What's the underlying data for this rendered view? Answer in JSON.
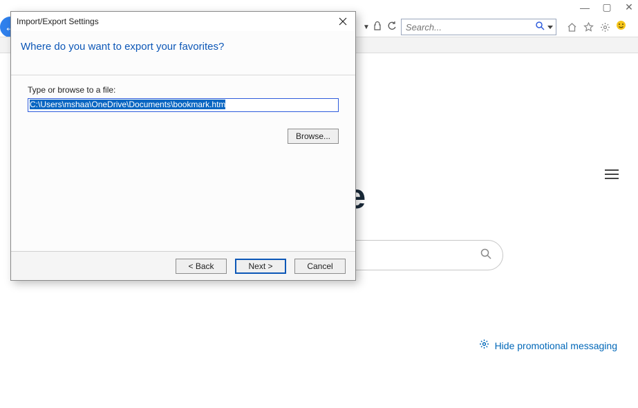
{
  "window_controls": {
    "min": "—",
    "max": "▢",
    "close": "✕"
  },
  "toolbar": {
    "lock_icon": "lock-icon",
    "refresh_icon": "refresh-icon",
    "search_placeholder": "Search...",
    "home_icon": "home-icon",
    "star_icon": "star-icon",
    "gear_icon": "gear-icon",
    "smiley_icon": "smiley-icon"
  },
  "start_page": {
    "title_fragment": "ge",
    "promo_link": "Hide promotional messaging"
  },
  "dialog": {
    "title": "Import/Export Settings",
    "heading": "Where do you want to export your favorites?",
    "field_label": "Type or browse to a file:",
    "path_value": "C:\\Users\\mshaa\\OneDrive\\Documents\\bookmark.htm",
    "browse_label": "Browse...",
    "back_label": "< Back",
    "next_label": "Next >",
    "cancel_label": "Cancel"
  }
}
